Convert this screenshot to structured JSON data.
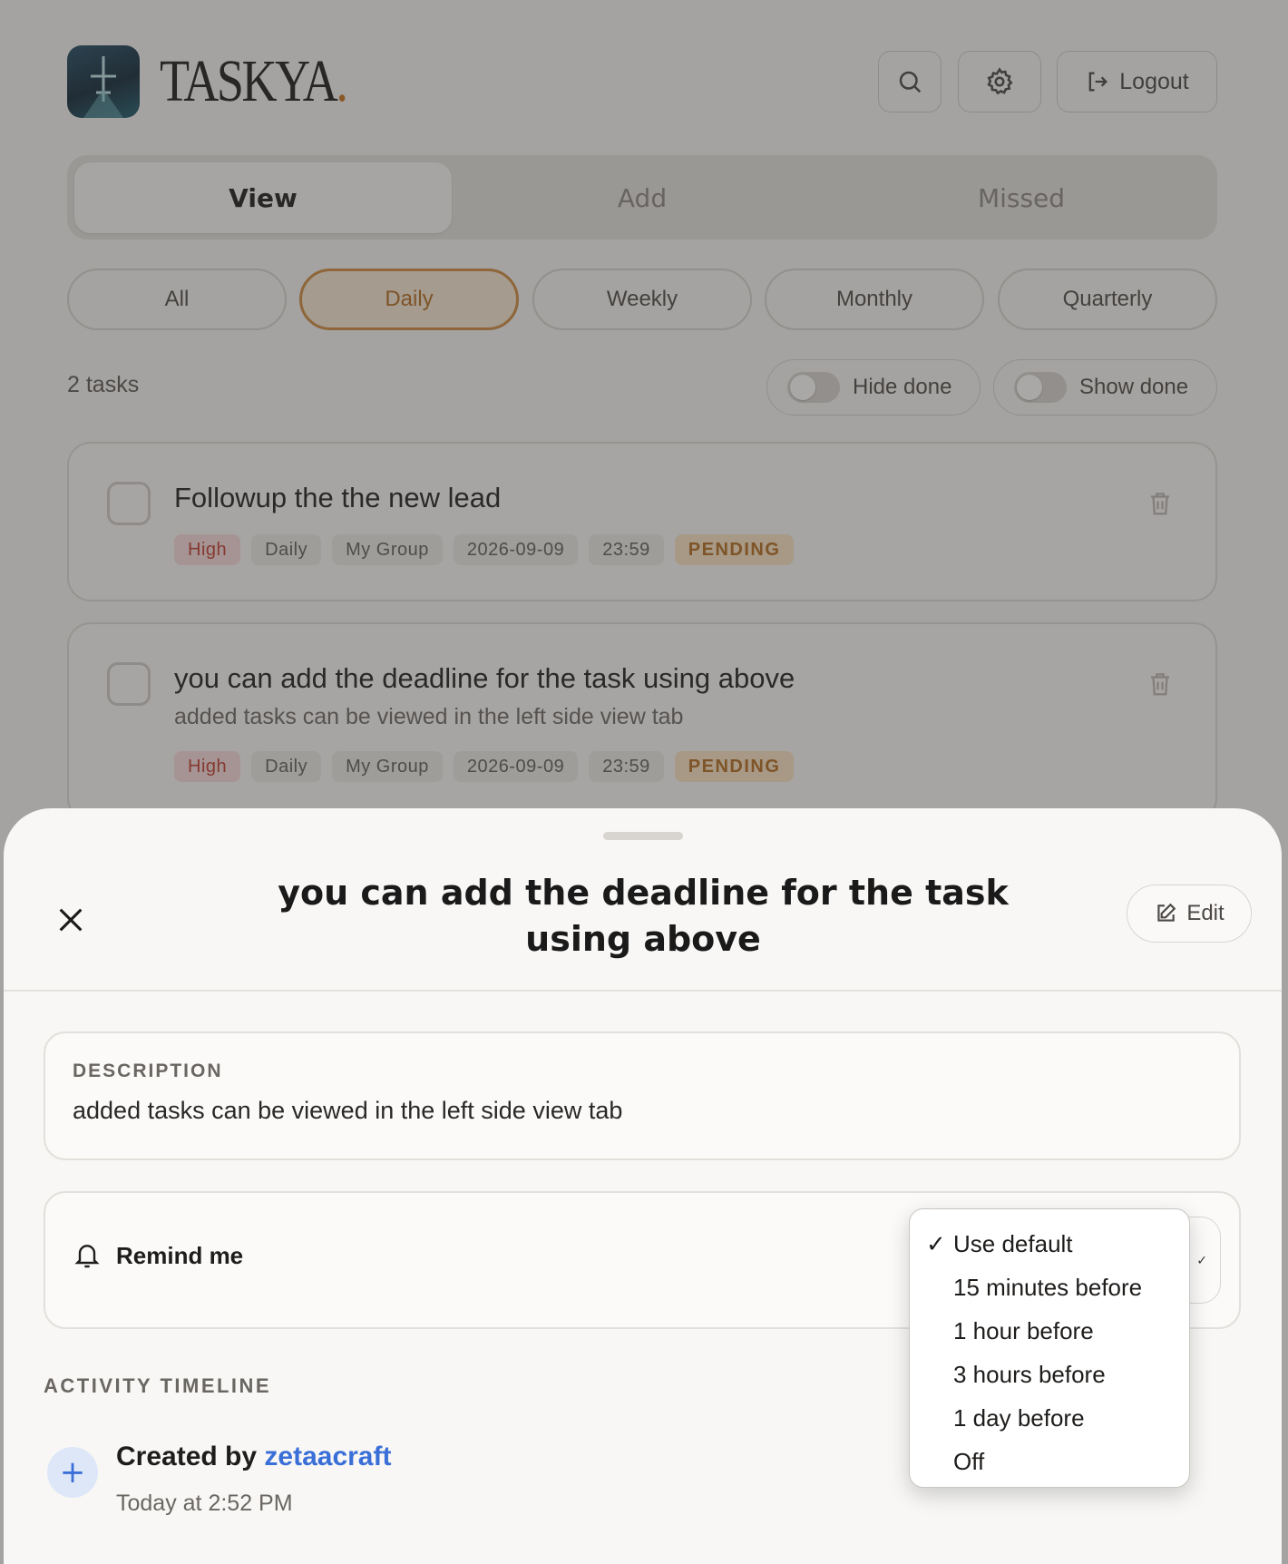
{
  "header": {
    "brand": "TASKYA",
    "brand_dot": ".",
    "logout_label": "Logout"
  },
  "tabs": [
    {
      "label": "View",
      "active": true
    },
    {
      "label": "Add",
      "active": false
    },
    {
      "label": "Missed",
      "active": false
    }
  ],
  "filters": [
    {
      "label": "All",
      "active": false
    },
    {
      "label": "Daily",
      "active": true
    },
    {
      "label": "Weekly",
      "active": false
    },
    {
      "label": "Monthly",
      "active": false
    },
    {
      "label": "Quarterly",
      "active": false
    }
  ],
  "task_count": "2 tasks",
  "toggles": {
    "hide_done": "Hide done",
    "show_done": "Show done"
  },
  "tasks": [
    {
      "title": "Followup the the new lead",
      "description": "",
      "tags": {
        "priority": "High",
        "frequency": "Daily",
        "group": "My Group",
        "date": "2026-09-09",
        "time": "23:59",
        "status": "PENDING"
      }
    },
    {
      "title": "you can add the deadline for the task using above",
      "description": "added tasks can be viewed in the left side view tab",
      "tags": {
        "priority": "High",
        "frequency": "Daily",
        "group": "My Group",
        "date": "2026-09-09",
        "time": "23:59",
        "status": "PENDING"
      }
    }
  ],
  "sheet": {
    "title": "you can add the deadline for the task using above",
    "edit_label": "Edit",
    "description_label": "DESCRIPTION",
    "description_text": "added tasks can be viewed in the left side view tab",
    "remind_label": "Remind me",
    "activity_label": "ACTIVITY TIMELINE",
    "activity": {
      "created_prefix": "Created by",
      "user": "zetaacraft",
      "time": "Today at 2:52 PM"
    }
  },
  "reminder_dropdown": {
    "selected": "Use default",
    "options": [
      "Use default",
      "15 minutes before",
      "1 hour before",
      "3 hours before",
      "1 day before",
      "Off"
    ]
  },
  "colors": {
    "accent": "#cf8a3d",
    "priority_high": "#c0392b",
    "link": "#3b6fd8"
  }
}
